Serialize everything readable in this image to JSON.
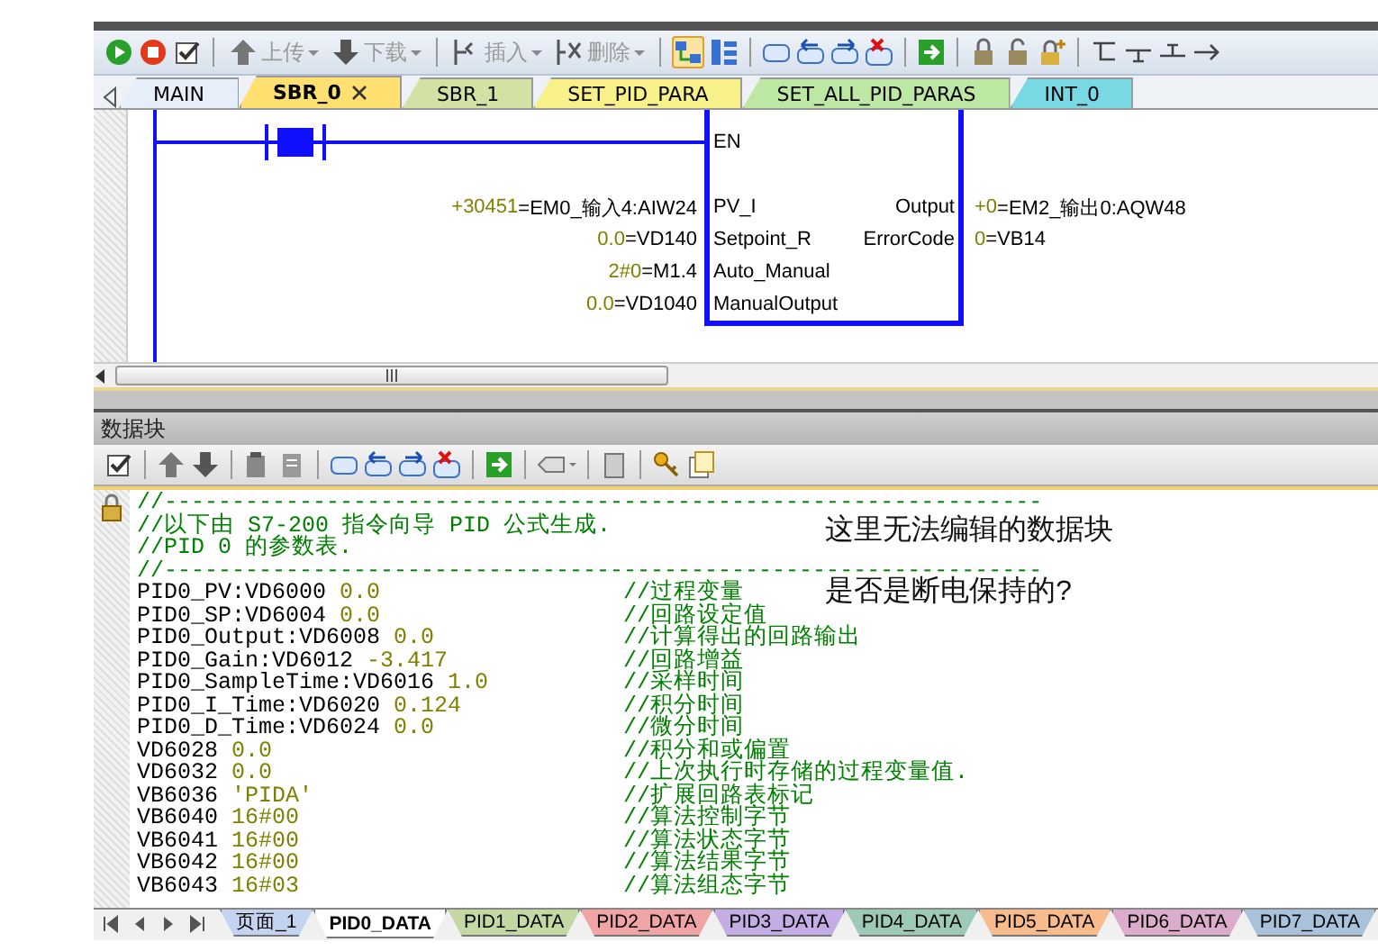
{
  "toolbar": {
    "menu_buttons": [
      {
        "label": "上传",
        "disabled": true
      },
      {
        "label": "下载",
        "disabled": true
      },
      {
        "label": "插入",
        "disabled": true
      },
      {
        "label": "删除",
        "disabled": true
      }
    ]
  },
  "program_tabs": [
    {
      "label": "MAIN",
      "selected": false,
      "color": "#e6eefa",
      "closable": false
    },
    {
      "label": "SBR_0",
      "selected": true,
      "color": "#ffe070",
      "closable": true
    },
    {
      "label": "SBR_1",
      "selected": false,
      "color": "#d2e2a4",
      "closable": false
    },
    {
      "label": "SET_PID_PARA",
      "selected": false,
      "color": "#f8f088",
      "closable": false
    },
    {
      "label": "SET_ALL_PID_PARAS",
      "selected": false,
      "color": "#bce8a4",
      "closable": false
    },
    {
      "label": "INT_0",
      "selected": false,
      "color": "#78d8e4",
      "closable": false
    }
  ],
  "ladder": {
    "enable_pin": "EN",
    "inputs": [
      {
        "pin": "PV_I",
        "value": "+30451",
        "address": "=EM0_输入4:AIW24"
      },
      {
        "pin": "Setpoint_R",
        "value": "0.0",
        "address": "=VD140"
      },
      {
        "pin": "Auto_Manual",
        "value": "2#0",
        "address": "=M1.4"
      },
      {
        "pin": "ManualOutput",
        "value": "0.0",
        "address": "=VD1040"
      }
    ],
    "outputs": [
      {
        "pin": "Output",
        "value": "+0",
        "address": "=EM2_输出0:AQW48"
      },
      {
        "pin": "ErrorCode",
        "value": "0",
        "address": "=VB14"
      }
    ]
  },
  "data_block": {
    "title": "数据块",
    "locked": true,
    "lines": [
      {
        "kind": "comment",
        "text": "//-----------------------------------------------------------------"
      },
      {
        "kind": "comment",
        "text": "//以下由 S7-200 指令向导 PID 公式生成."
      },
      {
        "kind": "comment",
        "text": "//PID 0 的参数表."
      },
      {
        "kind": "comment",
        "text": "//-----------------------------------------------------------------"
      },
      {
        "kind": "entry",
        "name": "PID0_PV:VD6000",
        "value": "0.0",
        "comment": "//过程变量"
      },
      {
        "kind": "entry",
        "name": "PID0_SP:VD6004",
        "value": "0.0",
        "comment": "//回路设定值"
      },
      {
        "kind": "entry",
        "name": "PID0_Output:VD6008",
        "value": "0.0",
        "comment": "//计算得出的回路输出"
      },
      {
        "kind": "entry",
        "name": "PID0_Gain:VD6012",
        "value": "-3.417",
        "comment": "//回路增益"
      },
      {
        "kind": "entry",
        "name": "PID0_SampleTime:VD6016",
        "value": "1.0",
        "comment": "//采样时间"
      },
      {
        "kind": "entry",
        "name": "PID0_I_Time:VD6020",
        "value": "0.124",
        "comment": "//积分时间"
      },
      {
        "kind": "entry",
        "name": "PID0_D_Time:VD6024",
        "value": "0.0",
        "comment": "//微分时间"
      },
      {
        "kind": "entry",
        "name": "VD6028",
        "value": "0.0",
        "comment": "//积分和或偏置"
      },
      {
        "kind": "entry",
        "name": "VD6032",
        "value": "0.0",
        "comment": "//上次执行时存储的过程变量值."
      },
      {
        "kind": "entry",
        "name": "VB6036",
        "value": "'PIDA'",
        "comment": "//扩展回路表标记"
      },
      {
        "kind": "entry",
        "name": "VB6040",
        "value": "16#00",
        "comment": "//算法控制字节"
      },
      {
        "kind": "entry",
        "name": "VB6041",
        "value": "16#00",
        "comment": "//算法状态字节"
      },
      {
        "kind": "entry",
        "name": "VB6042",
        "value": "16#00",
        "comment": "//算法结果字节"
      },
      {
        "kind": "entry",
        "name": "VB6043",
        "value": "16#03",
        "comment": "//算法组态字节"
      }
    ],
    "annotation": [
      "这里无法编辑的数据块",
      "是否是断电保持的?"
    ]
  },
  "sheet_tabs": [
    {
      "label": "页面_1",
      "selected": false,
      "color": "#c4d4f0"
    },
    {
      "label": "PID0_DATA",
      "selected": true,
      "color": "#ffffff"
    },
    {
      "label": "PID1_DATA",
      "selected": false,
      "color": "#c4d8a4"
    },
    {
      "label": "PID2_DATA",
      "selected": false,
      "color": "#f0a4a4"
    },
    {
      "label": "PID3_DATA",
      "selected": false,
      "color": "#c4ace4"
    },
    {
      "label": "PID4_DATA",
      "selected": false,
      "color": "#9ccab6"
    },
    {
      "label": "PID5_DATA",
      "selected": false,
      "color": "#f8bc8c"
    },
    {
      "label": "PID6_DATA",
      "selected": false,
      "color": "#dcaccc"
    },
    {
      "label": "PID7_DATA",
      "selected": false,
      "color": "#a8c2dc"
    }
  ]
}
